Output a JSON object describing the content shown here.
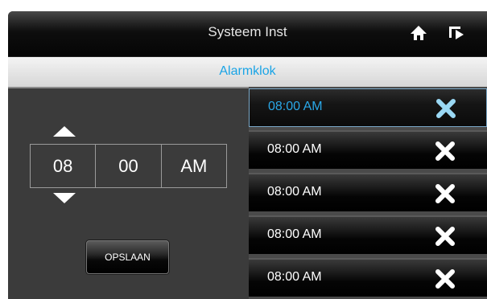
{
  "header": {
    "title": "Systeem Inst",
    "icons": [
      "home-icon",
      "back-icon"
    ]
  },
  "subheader": {
    "title": "Alarmklok"
  },
  "time_picker": {
    "hour": "08",
    "minute": "00",
    "ampm": "AM"
  },
  "save_button": {
    "label": "OPSLAAN"
  },
  "alarms": [
    {
      "time": "08:00 AM",
      "selected": true
    },
    {
      "time": "08:00 AM",
      "selected": false
    },
    {
      "time": "08:00 AM",
      "selected": false
    },
    {
      "time": "08:00 AM",
      "selected": false
    },
    {
      "time": "08:00 AM",
      "selected": false
    }
  ],
  "colors": {
    "accent": "#1aa4e6",
    "selected_x": "#9ad8f4",
    "background": "#3b3b3b"
  }
}
